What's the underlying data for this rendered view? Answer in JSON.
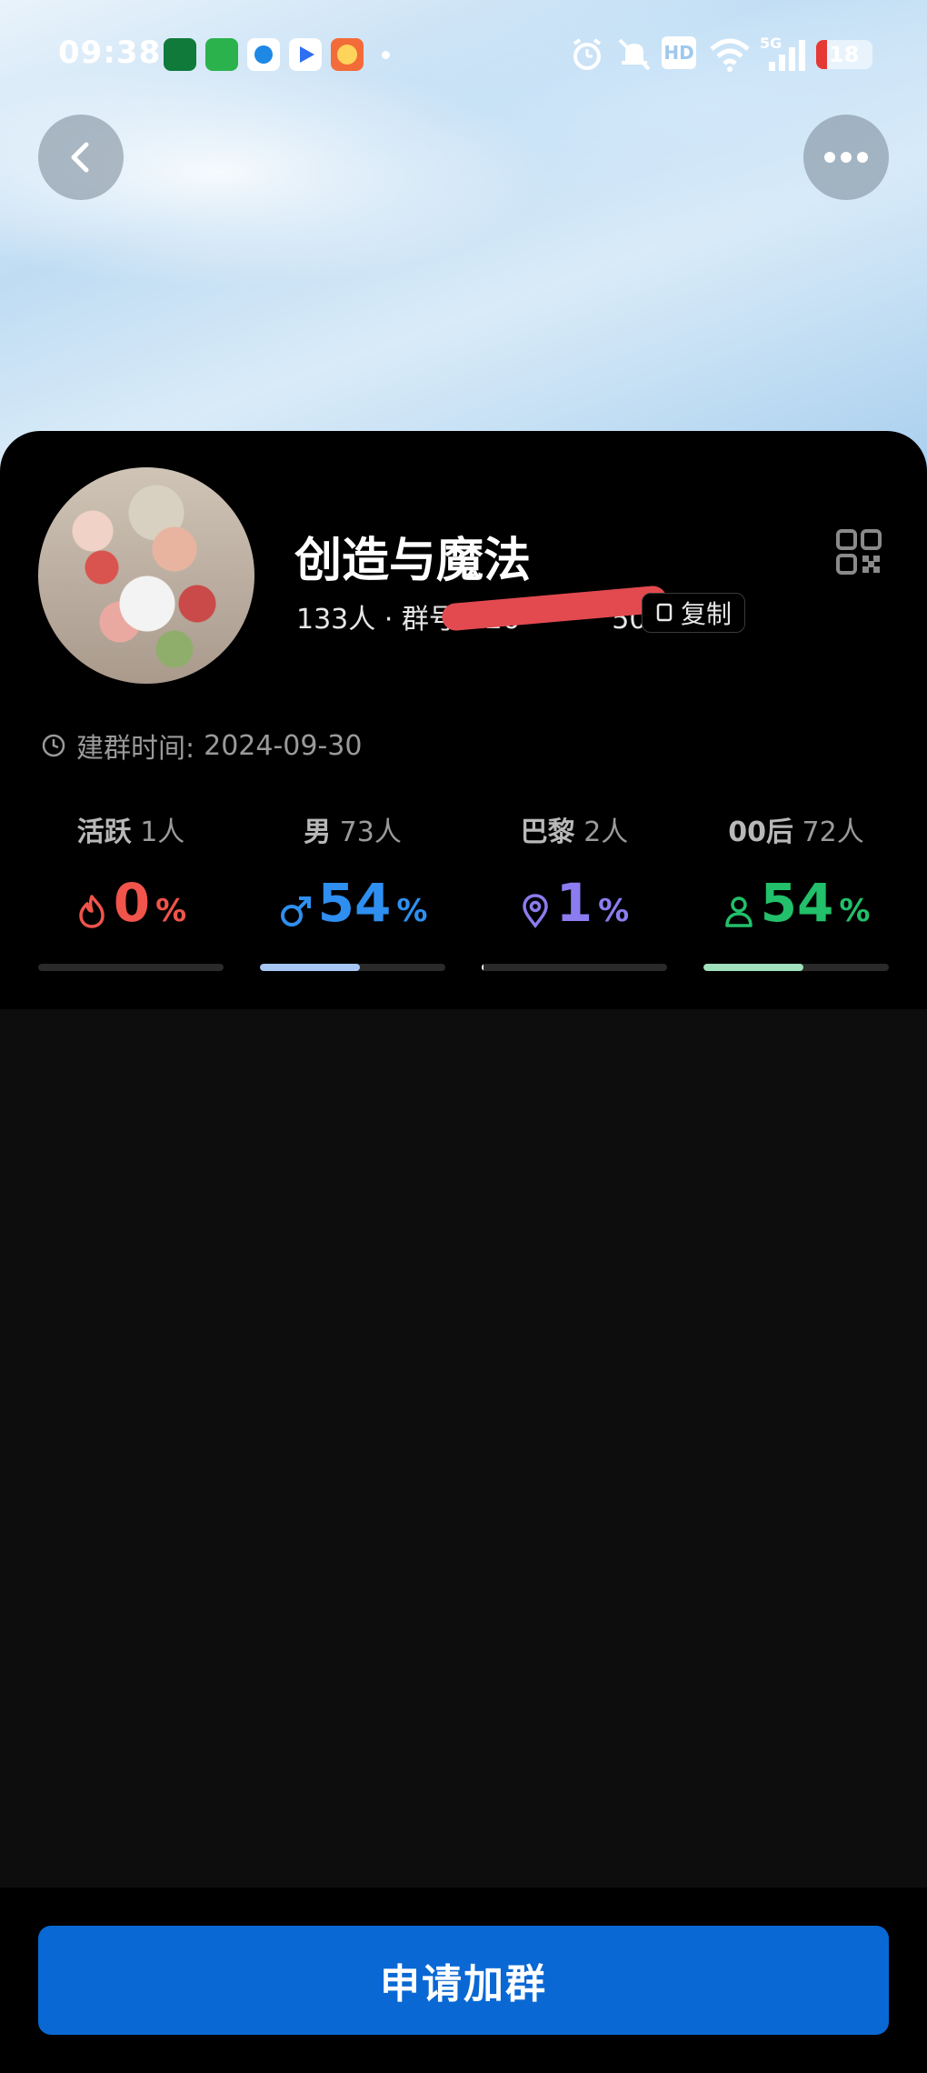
{
  "status_bar": {
    "time": "09:38",
    "battery_level": "18",
    "network": "5G",
    "hd_label": "HD",
    "icons": [
      "oppo-app-icon",
      "messages-app-icon",
      "browser-app-icon",
      "video-app-icon",
      "game-app-icon",
      "alarm-icon",
      "mute-icon",
      "hd-icon",
      "wifi-icon",
      "signal-icon",
      "battery-icon"
    ]
  },
  "group": {
    "name": "创造与魔法",
    "members": "133人",
    "separator": "·",
    "id_label": "群号:",
    "id_visible_start": "26",
    "id_visible_end": "50",
    "copy_label": "复制",
    "created_label": "建群时间:",
    "created_date": "2024-09-30"
  },
  "stats": [
    {
      "title": "活跃",
      "count": "1人",
      "value": "0",
      "unit": "%",
      "color": "#f0544b",
      "fill": 0.0,
      "bar_color": "#f0544b",
      "icon": "fire-icon"
    },
    {
      "title": "男",
      "count": "73人",
      "value": "54",
      "unit": "%",
      "color": "#2e8ff0",
      "fill": 0.54,
      "bar_color": "#a6c6f4",
      "icon": "male-icon"
    },
    {
      "title": "巴黎",
      "count": "2人",
      "value": "1",
      "unit": "%",
      "color": "#8b7cf0",
      "fill": 0.01,
      "bar_color": "#ffffff",
      "icon": "location-pin-icon"
    },
    {
      "title": "00后",
      "count": "72人",
      "value": "54",
      "unit": "%",
      "color": "#22c06a",
      "fill": 0.54,
      "bar_color": "#9fe0bd",
      "icon": "person-icon"
    }
  ],
  "actions": {
    "join_label": "申请加群"
  },
  "colors": {
    "accent": "#0a68d4",
    "card_bg": "#000000",
    "page_bg": "#0d0d0d"
  }
}
